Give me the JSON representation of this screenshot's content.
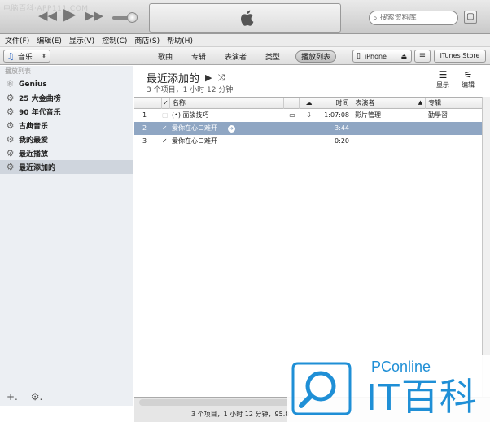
{
  "watermark_top": "电脑百科·APP111.COM",
  "search": {
    "placeholder": "搜索资料库"
  },
  "menu": [
    "文件(F)",
    "编辑(E)",
    "显示(V)",
    "控制(C)",
    "商店(S)",
    "帮助(H)"
  ],
  "library": {
    "label": "音乐",
    "icon": "music-note-icon"
  },
  "tabs": [
    {
      "label": "歌曲",
      "active": false
    },
    {
      "label": "专辑",
      "active": false
    },
    {
      "label": "表演者",
      "active": false
    },
    {
      "label": "类型",
      "active": false
    },
    {
      "label": "播放列表",
      "active": true
    }
  ],
  "device": {
    "label": "iPhone"
  },
  "store": {
    "label": "iTunes Store"
  },
  "sidebar": {
    "heading": "播放列表",
    "items": [
      {
        "label": "Genius",
        "icon": "genius-icon",
        "selected": false
      },
      {
        "label": "25 大金曲榜",
        "icon": "gear-icon",
        "selected": false
      },
      {
        "label": "90 年代音乐",
        "icon": "gear-icon",
        "selected": false
      },
      {
        "label": "古典音乐",
        "icon": "gear-icon",
        "selected": false
      },
      {
        "label": "我的最爱",
        "icon": "gear-icon",
        "selected": false
      },
      {
        "label": "最近播放",
        "icon": "gear-icon",
        "selected": false
      },
      {
        "label": "最近添加的",
        "icon": "gear-icon",
        "selected": true
      }
    ]
  },
  "playlist": {
    "title": "最近添加的",
    "subtitle": "3 个项目，1 小时 12 分钟",
    "show_label": "显示",
    "edit_label": "编辑"
  },
  "table": {
    "columns": [
      "名称",
      "时间",
      "表演者",
      "专辑"
    ],
    "rows": [
      {
        "index": "1",
        "name": "面談技巧",
        "time": "1:07:08",
        "artist": "影片管理",
        "album": "勤學習",
        "selected": false,
        "checked": false,
        "has_screen": true,
        "has_cloud": true
      },
      {
        "index": "2",
        "name": "爱你在心口难开",
        "time": "3:44",
        "artist": "",
        "album": "",
        "selected": true,
        "checked": true,
        "has_screen": false,
        "has_cloud": false
      },
      {
        "index": "3",
        "name": "爱你在心口难开",
        "time": "0:20",
        "artist": "",
        "album": "",
        "selected": false,
        "checked": true,
        "has_screen": false,
        "has_cloud": false
      }
    ]
  },
  "status": {
    "text": "3 个项目，1 小时 12 分钟，95.8"
  },
  "watermark": {
    "small": "PConline",
    "big": "IT百科"
  },
  "colors": {
    "selection": "#8fa6c3",
    "brand": "#1f8fd6"
  }
}
